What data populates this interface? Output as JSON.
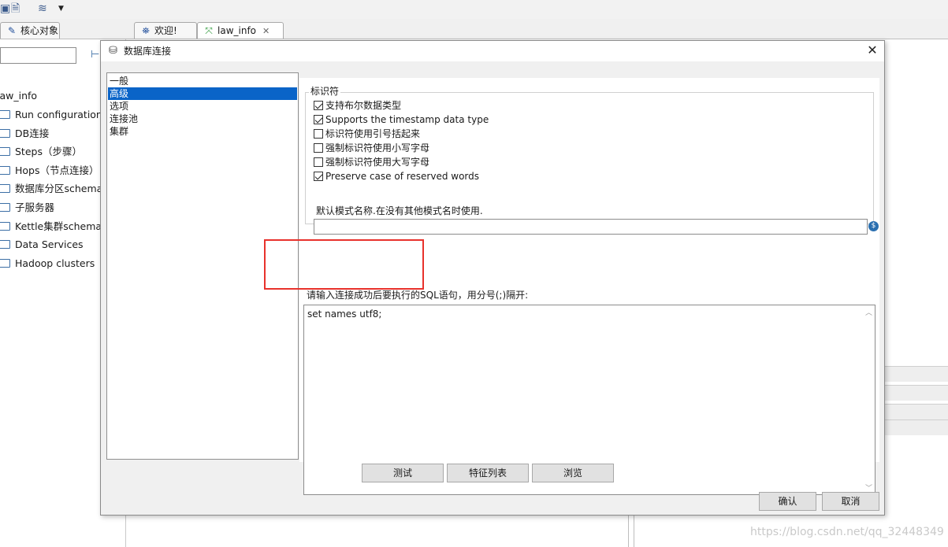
{
  "tabs": {
    "core_objects": "核心对象",
    "welcome": "欢迎!",
    "law_info": "law_info"
  },
  "tree": {
    "root": "law_info",
    "items": [
      "Run configuration",
      "DB连接",
      "Steps（步骤）",
      "Hops（节点连接）",
      "数据库分区schema",
      "子服务器",
      "Kettle集群schemas",
      "Data Services",
      "Hadoop clusters"
    ]
  },
  "dialog": {
    "title": "数据库连接",
    "nav": [
      "一般",
      "高级",
      "选项",
      "连接池",
      "集群"
    ],
    "nav_selected_index": 1,
    "group_title": "标识符",
    "options": [
      {
        "label": "支持布尔数据类型",
        "checked": true
      },
      {
        "label": "Supports the timestamp data type",
        "checked": true
      },
      {
        "label": "标识符使用引号括起来",
        "checked": false
      },
      {
        "label": "强制标识符使用小写字母",
        "checked": false
      },
      {
        "label": "强制标识符使用大写字母",
        "checked": false
      },
      {
        "label": "Preserve case of reserved words",
        "checked": true
      }
    ],
    "default_schema_label": "默认模式名称.在没有其他模式名时使用.",
    "default_schema_value": "",
    "sql_label": "请输入连接成功后要执行的SQL语句，用分号(;)隔开:",
    "sql_value": "set names utf8;",
    "buttons": {
      "test": "测试",
      "feature_list": "特征列表",
      "explore": "浏览",
      "ok": "确认",
      "cancel": "取消"
    }
  },
  "watermark": "https://blog.csdn.net/qq_32448349",
  "colors": {
    "selection": "#0a64c8",
    "highlight_box": "#e8322c"
  }
}
